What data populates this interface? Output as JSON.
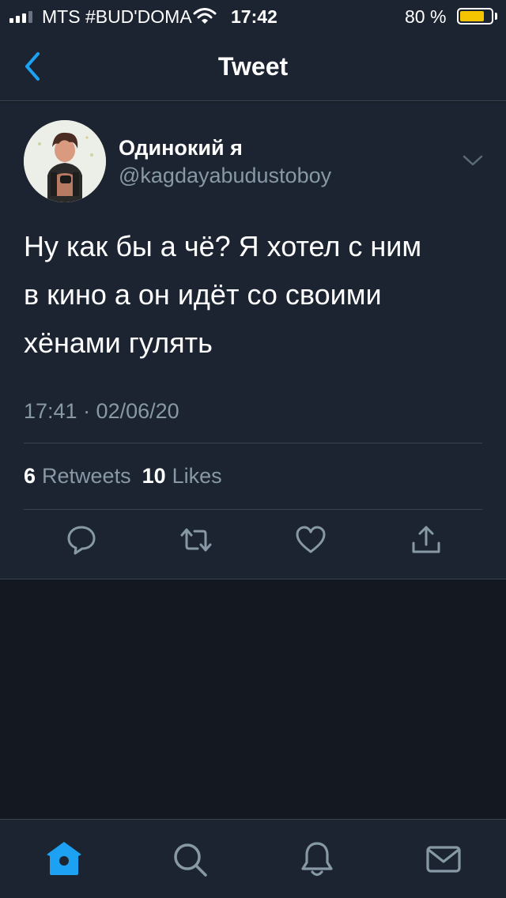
{
  "status_bar": {
    "carrier": "MTS #BUD'DOMA",
    "time": "17:42",
    "battery_percent": "80 %",
    "battery_level": 0.8,
    "icons": [
      "signal-icon",
      "wifi-icon",
      "battery-icon"
    ]
  },
  "nav": {
    "title": "Tweet",
    "back_icon": "chevron-left-icon"
  },
  "tweet": {
    "author_name": "Одинокий я",
    "author_handle": "@kagdayabudustoboy",
    "text_lines": [
      "Ну как бы а чё? Я хотел с ним",
      "в кино а он идёт со своими",
      "хёнами гулять"
    ],
    "timestamp": "17:41 · 02/06/20",
    "retweets_count": "6",
    "retweets_label": "Retweets",
    "likes_count": "10",
    "likes_label": "Likes",
    "actions": [
      "reply-icon",
      "retweet-icon",
      "like-icon",
      "share-icon"
    ]
  },
  "tab_bar": {
    "tabs": [
      "home-icon",
      "search-icon",
      "notifications-icon",
      "messages-icon"
    ],
    "active": "home-icon"
  },
  "colors": {
    "background": "#141820",
    "surface": "#1c2431",
    "accent": "#1da1f2",
    "secondary_text": "#8899a6",
    "divider": "#38444d",
    "battery": "#f5c400"
  }
}
